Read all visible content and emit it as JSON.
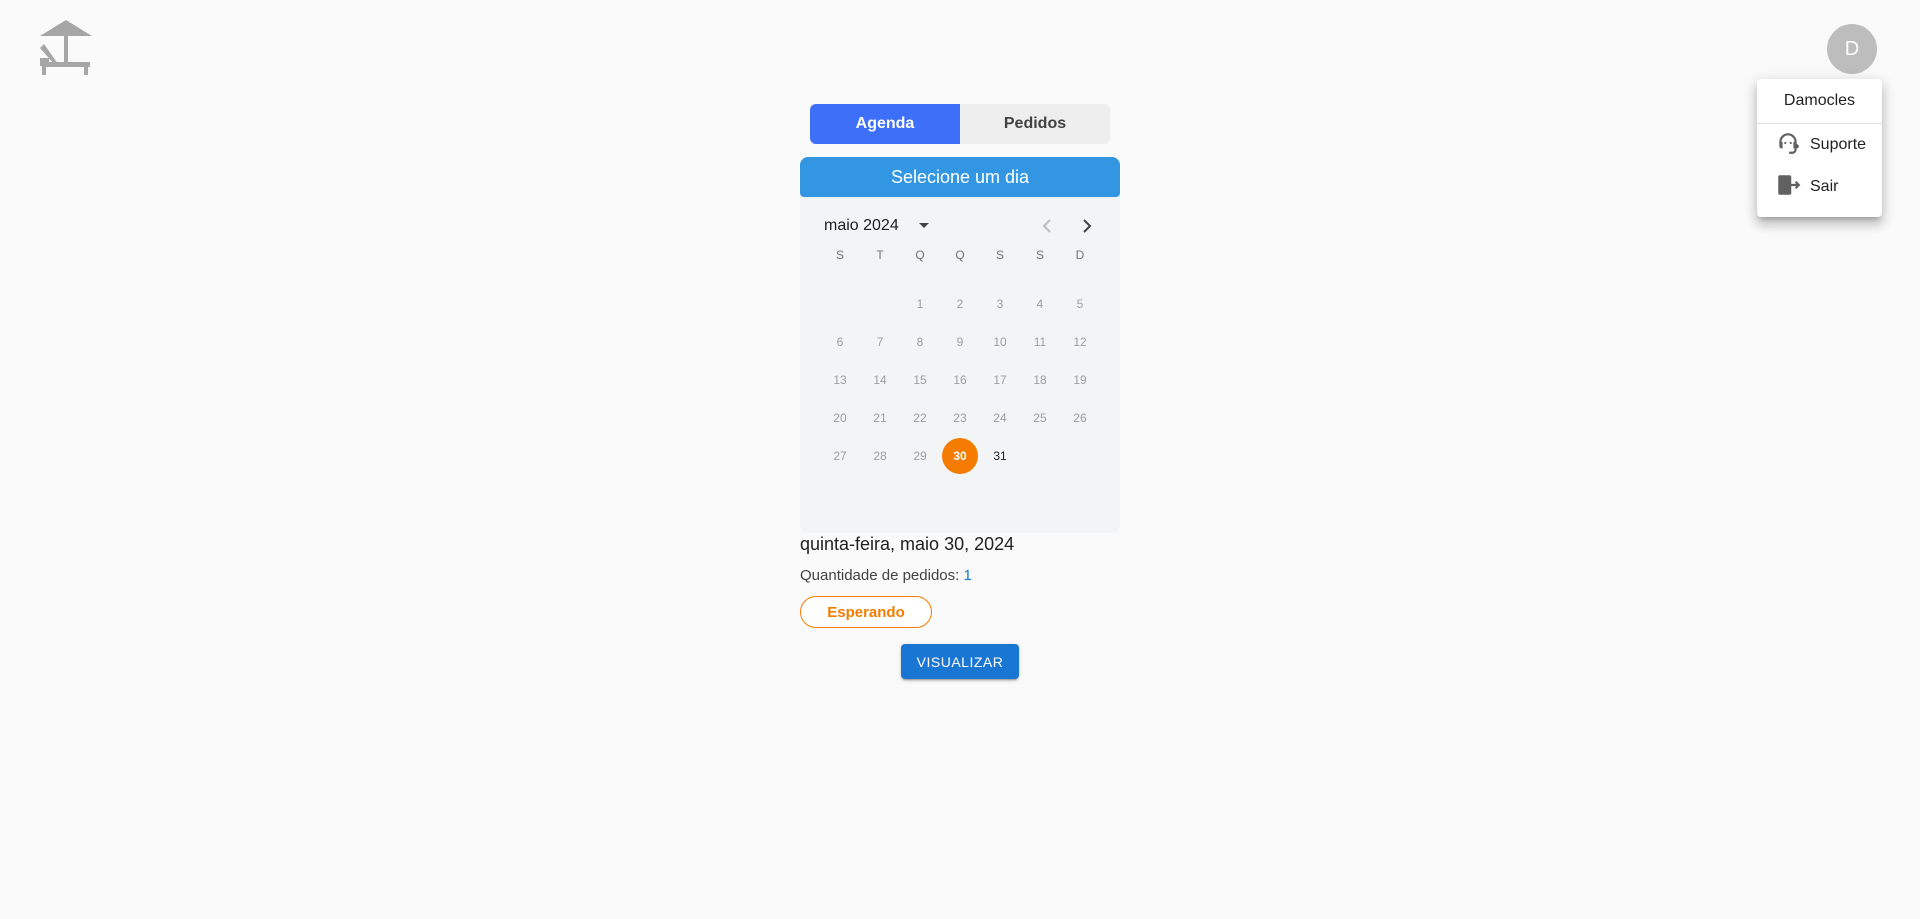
{
  "header": {
    "logo_icon": "beach-lounger-icon",
    "avatar_initial": "D"
  },
  "user_menu": {
    "username": "Damocles",
    "items": [
      {
        "label": "Suporte",
        "icon": "support-agent-icon"
      },
      {
        "label": "Sair",
        "icon": "logout-icon"
      }
    ]
  },
  "tabs": [
    {
      "label": "Agenda",
      "active": true
    },
    {
      "label": "Pedidos",
      "active": false
    }
  ],
  "calendar": {
    "header": "Selecione um dia",
    "month_label": "maio 2024",
    "weekdays": [
      "S",
      "T",
      "Q",
      "Q",
      "S",
      "S",
      "D"
    ],
    "weeks": [
      [
        "",
        "",
        "1",
        "2",
        "3",
        "4",
        "5"
      ],
      [
        "6",
        "7",
        "8",
        "9",
        "10",
        "11",
        "12"
      ],
      [
        "13",
        "14",
        "15",
        "16",
        "17",
        "18",
        "19"
      ],
      [
        "20",
        "21",
        "22",
        "23",
        "24",
        "25",
        "26"
      ],
      [
        "27",
        "28",
        "29",
        "30",
        "31",
        "",
        ""
      ]
    ],
    "selected_day": "30",
    "available_days": [
      "31"
    ]
  },
  "details": {
    "date_title": "quinta-feira, maio 30, 2024",
    "orders_label": "Quantidade de pedidos: ",
    "orders_count": "1",
    "status": "Esperando",
    "view_button": "VISUALIZAR"
  },
  "colors": {
    "tab_active": "#3d6ff8",
    "calendar_header": "#3396e2",
    "selected_day": "#f57c00",
    "status": "#f57c00",
    "primary_button": "#1976d2"
  }
}
